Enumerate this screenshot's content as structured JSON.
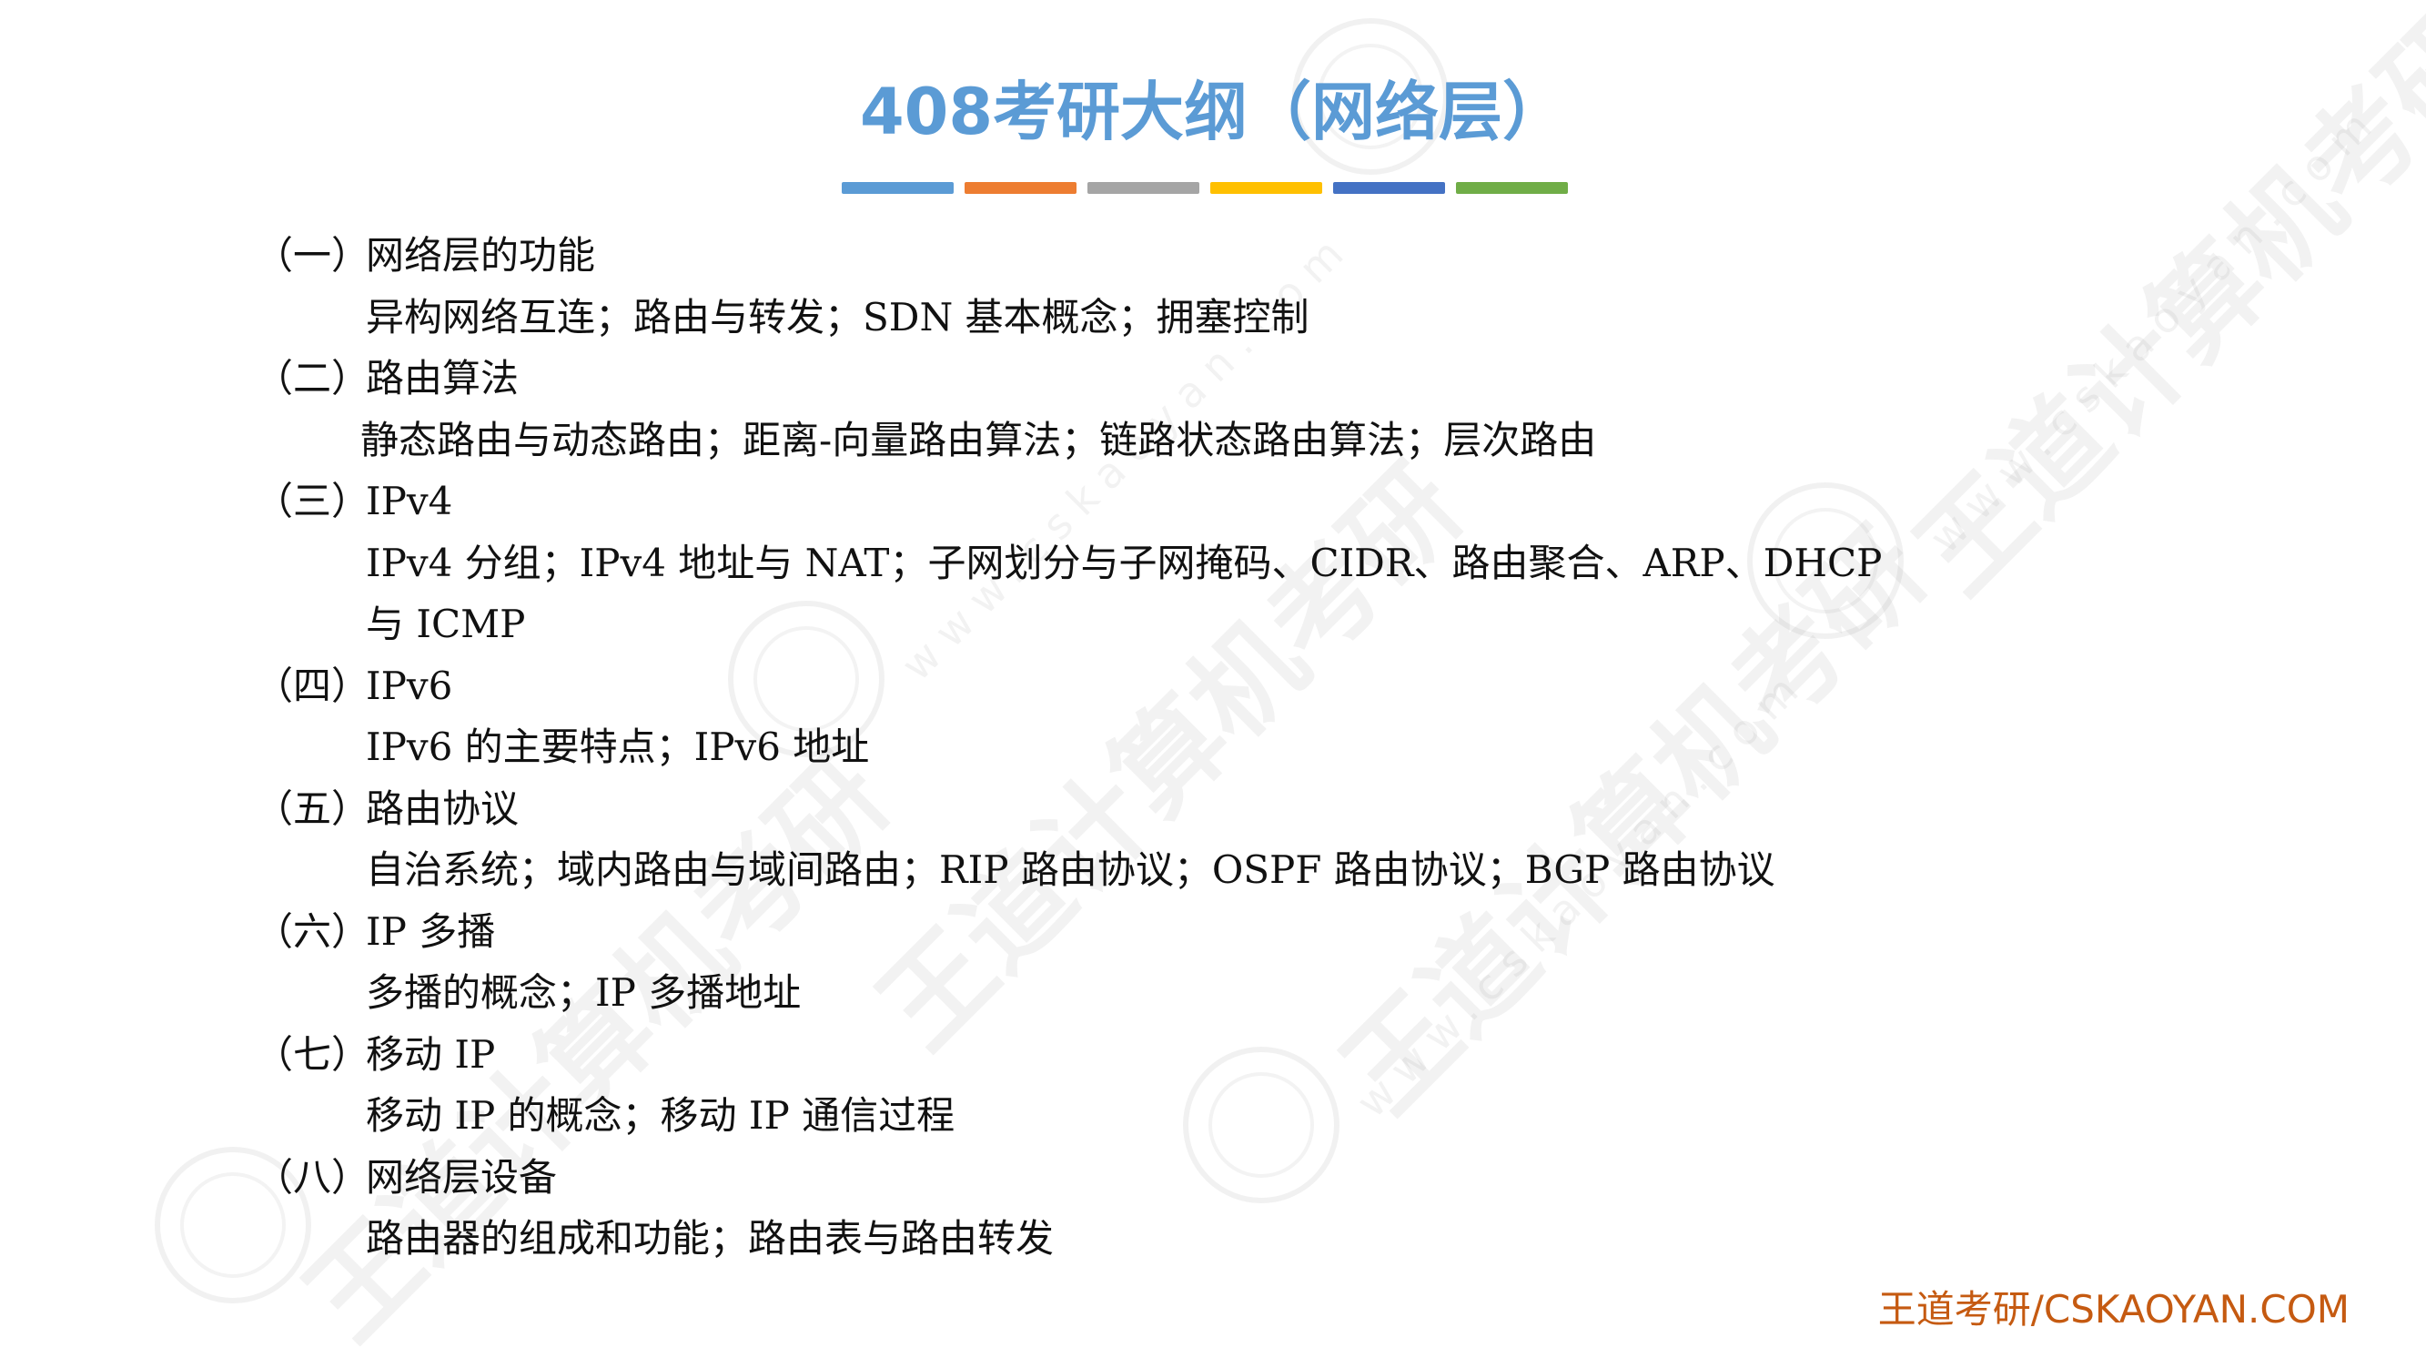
{
  "title": "408考研大纲（网络层）",
  "title_bar_colors": [
    "#5b9bd5",
    "#ed7d31",
    "#a5a5a5",
    "#ffc000",
    "#4472c4",
    "#70ad47"
  ],
  "watermark": {
    "text": "王道计算机考研",
    "url": "www.cskaoyan.com"
  },
  "sections": [
    {
      "num": "（一）",
      "title": "网络层的功能",
      "body": "异构网络互连；路由与转发；SDN 基本概念；拥塞控制"
    },
    {
      "num": "（二）",
      "title": "路由算法",
      "body": "静态路由与动态路由；距离-向量路由算法；链路状态路由算法；层次路由"
    },
    {
      "num": "（三）",
      "title": "IPv4",
      "body": "IPv4 分组；IPv4 地址与 NAT；子网划分与子网掩码、CIDR、路由聚合、ARP、DHCP 与 ICMP"
    },
    {
      "num": "（四）",
      "title": "IPv6",
      "body": "IPv6 的主要特点；IPv6 地址"
    },
    {
      "num": "（五）",
      "title": "路由协议",
      "body": "自治系统；域内路由与域间路由；RIP 路由协议；OSPF 路由协议；BGP 路由协议"
    },
    {
      "num": "（六）",
      "title": "IP 多播",
      "body": "多播的概念；IP 多播地址"
    },
    {
      "num": "（七）",
      "title": "移动 IP",
      "body": "移动 IP 的概念；移动 IP 通信过程"
    },
    {
      "num": "（八）",
      "title": "网络层设备",
      "body": "路由器的组成和功能；路由表与路由转发"
    }
  ],
  "footer": "王道考研/CSKAOYAN.COM"
}
